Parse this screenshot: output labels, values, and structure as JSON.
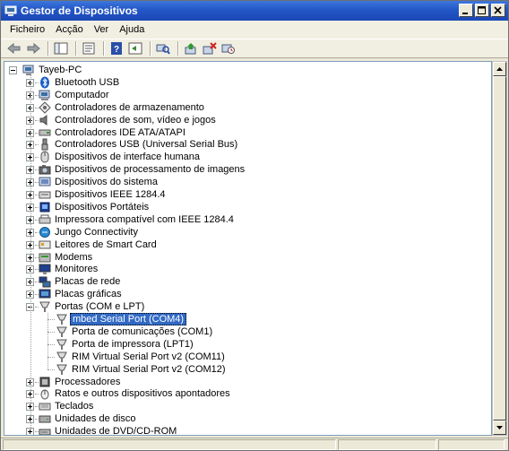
{
  "window": {
    "title": "Gestor de Dispositivos"
  },
  "menu": [
    "Ficheiro",
    "Acção",
    "Ver",
    "Ajuda"
  ],
  "toolbar": [
    "back-icon",
    "forward-icon",
    "sep",
    "console-tree-icon",
    "sep",
    "properties-icon",
    "sep",
    "help-icon",
    "view-icon",
    "sep",
    "scan-hardware-icon",
    "sep",
    "update-driver-icon",
    "uninstall-icon",
    "disable-icon"
  ],
  "tree": {
    "root": "Tayeb-PC",
    "categories": [
      {
        "label": "Bluetooth USB",
        "icon": "bluetooth-icon"
      },
      {
        "label": "Computador",
        "icon": "computer-icon"
      },
      {
        "label": "Controladores de armazenamento",
        "icon": "storage-controller-icon"
      },
      {
        "label": "Controladores de som, vídeo e jogos",
        "icon": "sound-icon"
      },
      {
        "label": "Controladores IDE ATA/ATAPI",
        "icon": "ide-icon"
      },
      {
        "label": "Controladores USB (Universal Serial Bus)",
        "icon": "usb-icon"
      },
      {
        "label": "Dispositivos de interface humana",
        "icon": "hid-icon"
      },
      {
        "label": "Dispositivos de processamento de imagens",
        "icon": "imaging-icon"
      },
      {
        "label": "Dispositivos do sistema",
        "icon": "system-device-icon"
      },
      {
        "label": "Dispositivos IEEE 1284.4",
        "icon": "ieee-icon"
      },
      {
        "label": "Dispositivos Portáteis",
        "icon": "portable-device-icon"
      },
      {
        "label": "Impressora compatível com IEEE 1284.4",
        "icon": "printer-icon"
      },
      {
        "label": "Jungo Connectivity",
        "icon": "jungo-icon"
      },
      {
        "label": "Leitores de Smart Card",
        "icon": "smartcard-icon"
      },
      {
        "label": "Modems",
        "icon": "modem-icon"
      },
      {
        "label": "Monitores",
        "icon": "monitor-icon"
      },
      {
        "label": "Placas de rede",
        "icon": "network-icon"
      },
      {
        "label": "Placas gráficas",
        "icon": "display-adapter-icon"
      },
      {
        "label": "Portas (COM e LPT)",
        "icon": "port-icon",
        "expanded": true
      },
      {
        "label": "Processadores",
        "icon": "processor-icon"
      },
      {
        "label": "Ratos e outros dispositivos apontadores",
        "icon": "mouse-icon"
      },
      {
        "label": "Teclados",
        "icon": "keyboard-icon"
      },
      {
        "label": "Unidades de disco",
        "icon": "disk-icon"
      },
      {
        "label": "Unidades de DVD/CD-ROM",
        "icon": "dvd-icon"
      }
    ],
    "ports_children": [
      {
        "label": "mbed Serial Port (COM4)",
        "selected": true
      },
      {
        "label": "Porta de comunicações (COM1)"
      },
      {
        "label": "Porta de impressora (LPT1)"
      },
      {
        "label": "RIM Virtual Serial Port v2 (COM11)"
      },
      {
        "label": "RIM Virtual Serial Port v2 (COM12)"
      }
    ]
  },
  "colors": {
    "title_bar": "#2356c6",
    "selection": "#316ac5"
  }
}
